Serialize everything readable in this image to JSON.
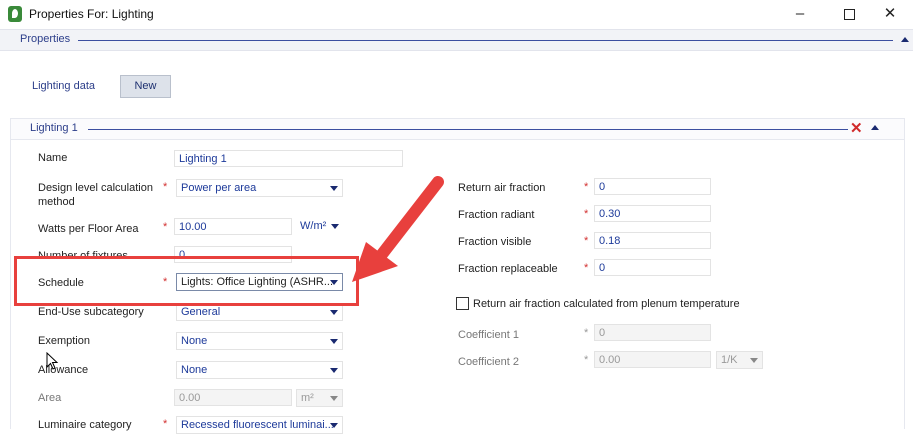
{
  "window": {
    "title": "Properties For: Lighting",
    "icon": "app-leaf-icon",
    "controls": [
      "minimize-icon",
      "maximize-icon",
      "close-icon"
    ]
  },
  "properties_header": {
    "label": "Properties"
  },
  "lighting_data": {
    "label": "Lighting data",
    "new_button": "New"
  },
  "section": {
    "title": "Lighting 1"
  },
  "left_form": {
    "name": {
      "label": "Name",
      "value": "Lighting 1"
    },
    "design_level": {
      "label_line1": "Design level calculation",
      "label_line2": "method",
      "required": "*",
      "value": "Power per area"
    },
    "watts": {
      "label": "Watts per Floor Area",
      "required": "*",
      "value": "10.00",
      "unit": "W/m²"
    },
    "fixtures": {
      "label": "Number of fixtures",
      "value": "0"
    },
    "schedule": {
      "label": "Schedule",
      "required": "*",
      "value": "Lights: Office Lighting (ASHR..."
    },
    "enduse": {
      "label": "End-Use subcategory",
      "value": "General"
    },
    "exemption": {
      "label": "Exemption",
      "value": "None"
    },
    "allowance": {
      "label": "Allowance",
      "value": "None"
    },
    "area": {
      "label": "Area",
      "value": "0.00",
      "unit": "m²"
    },
    "luminaire": {
      "label": "Luminaire category",
      "required": "*",
      "value": "Recessed fluorescent luminai..."
    }
  },
  "right_form": {
    "return_air": {
      "label": "Return air fraction",
      "required": "*",
      "value": "0"
    },
    "radiant": {
      "label": "Fraction radiant",
      "required": "*",
      "value": "0.30"
    },
    "visible": {
      "label": "Fraction visible",
      "required": "*",
      "value": "0.18"
    },
    "replaceable": {
      "label": "Fraction replaceable",
      "required": "*",
      "value": "0"
    },
    "plenum_checkbox": {
      "label": "Return air fraction calculated from plenum temperature",
      "checked": false
    },
    "coef1": {
      "label": "Coefficient 1",
      "required": "*",
      "value": "0"
    },
    "coef2": {
      "label": "Coefficient 2",
      "required": "*",
      "value": "0.00",
      "unit": "1/K"
    }
  },
  "colors": {
    "accent_blue": "#2c3e8a",
    "value_blue": "#1d3a9a",
    "required_red": "#d23030",
    "annotation_red": "#e8403d"
  }
}
